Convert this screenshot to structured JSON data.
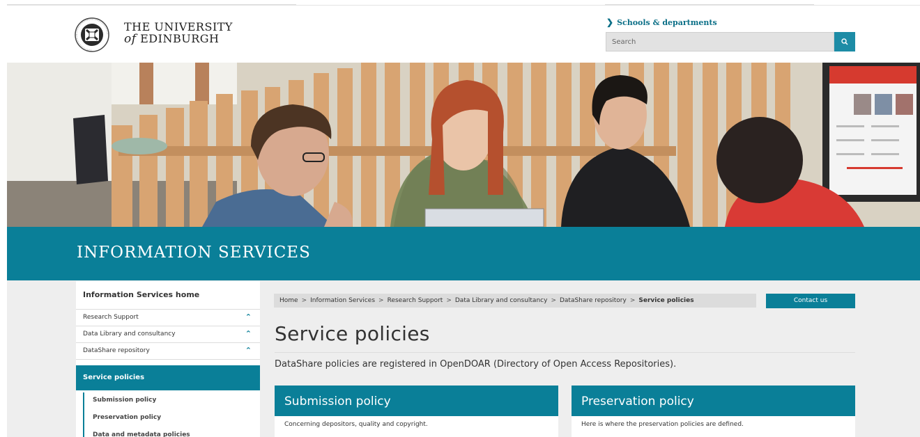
{
  "header": {
    "logo_line1": "THE UNIVERSITY",
    "logo_of": "of",
    "logo_line2": "EDINBURGH",
    "schools_link": "Schools & departments",
    "search_placeholder": "Search"
  },
  "banner": {
    "title": "INFORMATION SERVICES"
  },
  "leftnav": {
    "home": "Information Services home",
    "items": [
      {
        "label": "Research Support"
      },
      {
        "label": "Data Library and consultancy"
      },
      {
        "label": "DataShare repository"
      }
    ],
    "active": "Service policies",
    "subitems": [
      {
        "label": "Submission policy"
      },
      {
        "label": "Preservation policy"
      },
      {
        "label": "Data and metadata policies"
      }
    ]
  },
  "breadcrumb": {
    "items": [
      "Home",
      "Information Services",
      "Research Support",
      "Data Library and consultancy",
      "DataShare repository"
    ],
    "current": "Service policies",
    "separator": ">"
  },
  "contact_button": "Contact us",
  "main": {
    "title": "Service policies",
    "intro": "DataShare policies are registered in OpenDOAR (Directory of Open Access Repositories).",
    "cards": [
      {
        "title": "Submission policy",
        "text": "Concerning depositors, quality and copyright."
      },
      {
        "title": "Preservation policy",
        "text": "Here is where the preservation policies are defined."
      }
    ]
  },
  "colors": {
    "brand_teal": "#0a7f98",
    "search_button": "#1d8ca6"
  }
}
